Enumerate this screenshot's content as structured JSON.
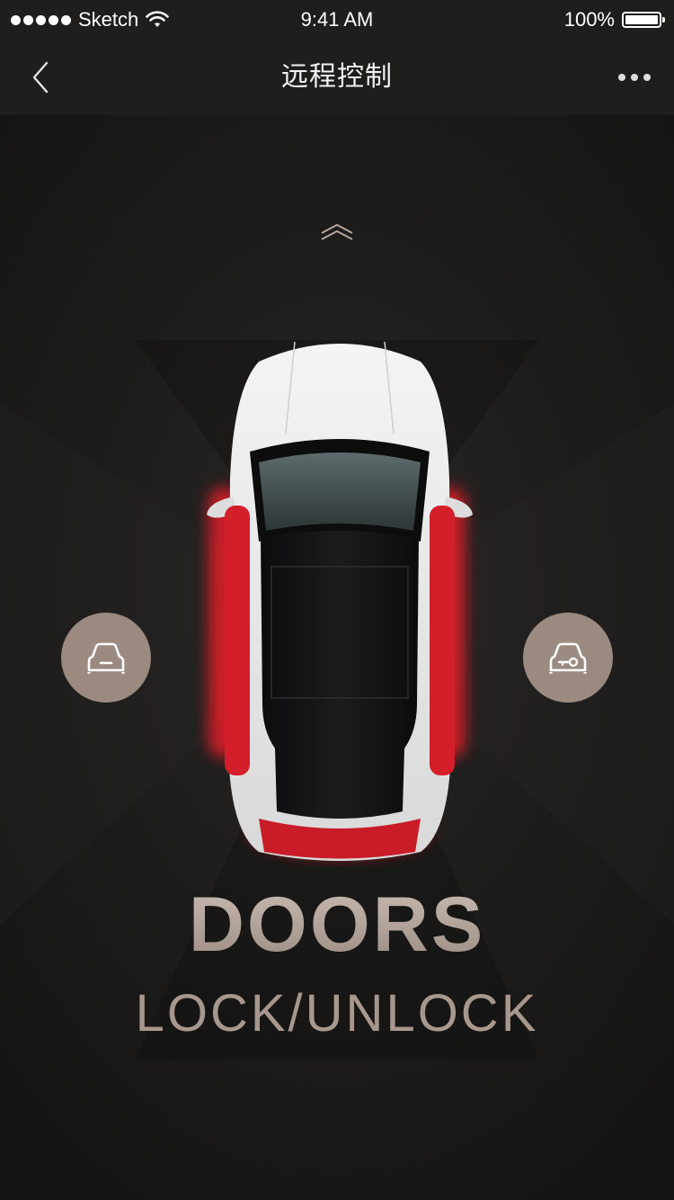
{
  "status_bar": {
    "carrier": "Sketch",
    "time": "9:41 AM",
    "battery": "100%"
  },
  "nav": {
    "title": "远程控制",
    "back_icon": "chevron-left-icon",
    "more_icon": "ellipsis-icon"
  },
  "feature": {
    "title": "DOORS",
    "subtitle": "LOCK/UNLOCK"
  },
  "controls": {
    "left_icon": "car-lock-icon",
    "right_icon": "car-key-icon"
  },
  "colors": {
    "background": "#1c1b1a",
    "button": "#9b8a80",
    "accent_red": "#e0202c",
    "text_gold": "#a8978c"
  }
}
